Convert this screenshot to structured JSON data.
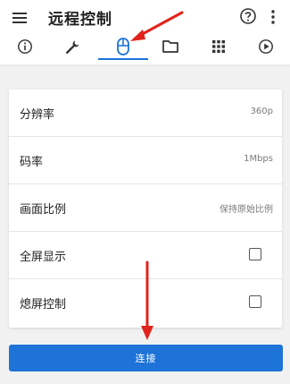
{
  "header": {
    "title": "远程控制",
    "menu_icon": "menu-icon",
    "help_icon": "help-circle-icon",
    "more_icon": "more-vert-icon"
  },
  "tabs": [
    {
      "icon": "info-icon",
      "active": false
    },
    {
      "icon": "wrench-icon",
      "active": false
    },
    {
      "icon": "mouse-icon",
      "active": true
    },
    {
      "icon": "folder-icon",
      "active": false
    },
    {
      "icon": "grid-icon",
      "active": false
    },
    {
      "icon": "play-circle-icon",
      "active": false
    }
  ],
  "settings": {
    "resolution": {
      "label": "分辨率",
      "value": "360p"
    },
    "bitrate": {
      "label": "码率",
      "value": "1Mbps"
    },
    "aspect": {
      "label": "画面比例",
      "value": "保持原始比例"
    },
    "fullscreen": {
      "label": "全屏显示",
      "checked": false
    },
    "screen_off": {
      "label": "熄屏控制",
      "checked": false
    }
  },
  "connect": {
    "label": "连接"
  },
  "colors": {
    "accent": "#1e73d8",
    "annotation": "#e0231c",
    "background": "#f1f1f1"
  }
}
